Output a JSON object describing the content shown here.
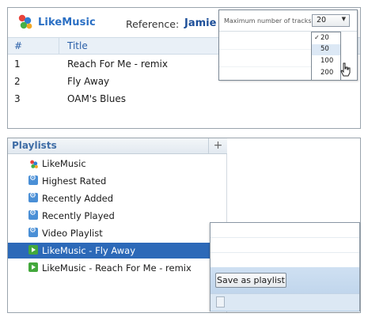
{
  "app": {
    "logo_text": "LikeMusic",
    "reference_label": "Reference:",
    "reference_name": "Jamie"
  },
  "tracks_control": {
    "label": "Maximum number of tracks:",
    "selected_value": "20",
    "options": [
      {
        "label": "20",
        "checked": true
      },
      {
        "label": "50",
        "hovered": true
      },
      {
        "label": "100"
      },
      {
        "label": "200"
      }
    ]
  },
  "table": {
    "columns": [
      "#",
      "Title"
    ],
    "rows": [
      {
        "num": "1",
        "title": "Reach For Me - remix"
      },
      {
        "num": "2",
        "title": "Fly Away"
      },
      {
        "num": "3",
        "title": "OAM's Blues"
      }
    ]
  },
  "playlists": {
    "header": "Playlists",
    "add_label": "+",
    "items": [
      {
        "label": "LikeMusic",
        "icon": "likemusic-logo-icon"
      },
      {
        "label": "Highest Rated",
        "icon": "smart-playlist-icon"
      },
      {
        "label": "Recently Added",
        "icon": "smart-playlist-icon"
      },
      {
        "label": "Recently Played",
        "icon": "smart-playlist-icon"
      },
      {
        "label": "Video Playlist",
        "icon": "smart-playlist-icon"
      },
      {
        "label": "LikeMusic - Fly Away",
        "icon": "playlist-icon",
        "selected": true
      },
      {
        "label": "LikeMusic - Reach For Me - remix",
        "icon": "playlist-icon"
      }
    ]
  },
  "save_popup": {
    "button_label": "Save as playlist"
  },
  "colors": {
    "accent": "#2c69b8",
    "header_text": "#2a5fa8",
    "brand": "#2a6fc4"
  }
}
